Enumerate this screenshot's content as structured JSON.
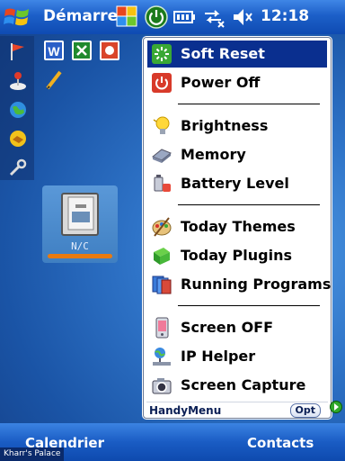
{
  "title_bar": {
    "start_label": "Démarrer",
    "clock": "12:18",
    "icons": [
      "windows-flag-icon",
      "multitask-icon",
      "power-icon",
      "battery-icon",
      "connectivity-icon",
      "volume-icon"
    ]
  },
  "today": {
    "left_icons": [
      "flag-icon",
      "joystick-icon",
      "globe-icon",
      "handshake-icon",
      "tools-icon"
    ],
    "app_tiles": [
      "word-icon",
      "excel-icon",
      "powerpoint-icon",
      "pen-icon"
    ],
    "widget_caption": "N/C",
    "widget_icon": "memory-card-icon"
  },
  "menu": {
    "title": "HandyMenu",
    "opt_label": "Opt",
    "items": [
      {
        "label": "Soft Reset",
        "icon": "reset-icon",
        "selected": true
      },
      {
        "label": "Power Off",
        "icon": "power-off-icon"
      },
      {
        "label": "Brightness",
        "icon": "lightbulb-icon"
      },
      {
        "label": "Memory",
        "icon": "memory-icon"
      },
      {
        "label": "Battery Level",
        "icon": "battery-level-icon"
      },
      {
        "label": "Today Themes",
        "icon": "palette-icon"
      },
      {
        "label": "Today Plugins",
        "icon": "plugin-icon"
      },
      {
        "label": "Running Programs",
        "icon": "programs-icon"
      },
      {
        "label": "Screen OFF",
        "icon": "phone-screen-icon"
      },
      {
        "label": "IP Helper",
        "icon": "network-icon"
      },
      {
        "label": "Screen Capture",
        "icon": "camera-icon"
      }
    ]
  },
  "softkeys": {
    "left": "Calendrier",
    "right": "Contacts"
  },
  "credit": "Kharr's Palace",
  "colors": {
    "selection": "#0a2f8f",
    "titlebar": "#1c5fc8",
    "accent_orange": "#e87a10"
  }
}
